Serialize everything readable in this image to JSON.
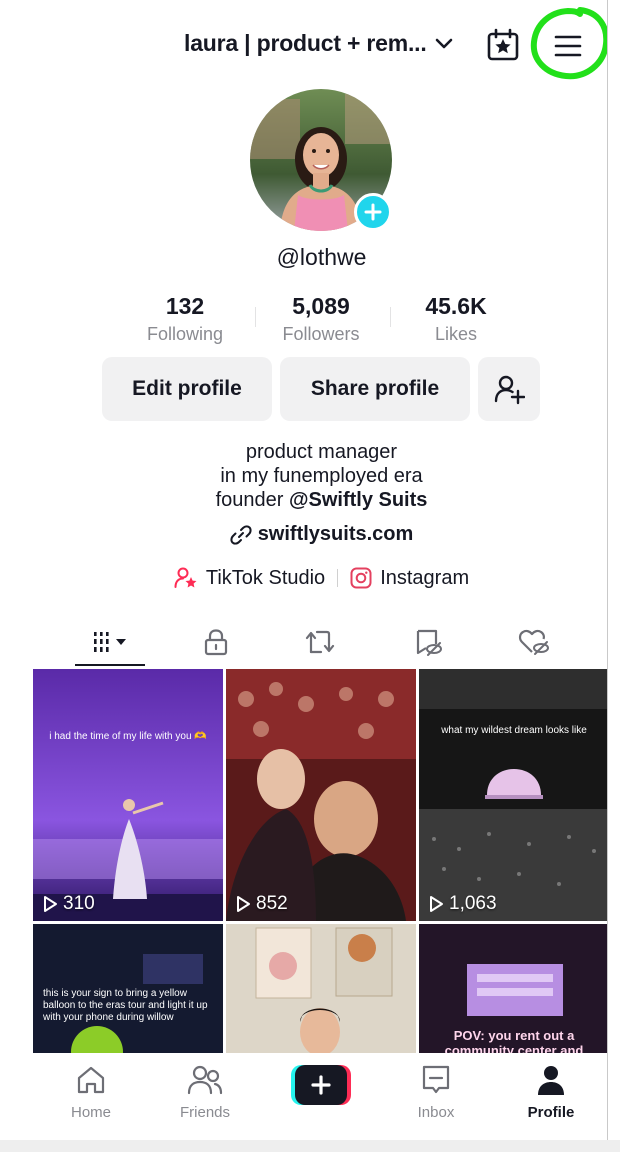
{
  "header": {
    "username": "laura | product + rem...",
    "icons": {
      "dropdown": "chevron-down-icon",
      "calendar": "calendar-star-icon",
      "menu": "hamburger-menu-icon"
    }
  },
  "profile": {
    "handle": "@lothwe",
    "stats": [
      {
        "value": "132",
        "label": "Following"
      },
      {
        "value": "5,089",
        "label": "Followers"
      },
      {
        "value": "45.6K",
        "label": "Likes"
      }
    ],
    "buttons": {
      "edit": "Edit profile",
      "share": "Share profile"
    },
    "bio": {
      "line1": "product manager",
      "line2": "in my funemployed era",
      "line3_prefix": "founder ",
      "line3_mention": "@Swiftly Suits"
    },
    "link": "swiftlysuits.com",
    "studio_label": "TikTok Studio",
    "instagram_label": "Instagram"
  },
  "videos": [
    {
      "views": "310",
      "caption": "i had the time of my life with you 🫶"
    },
    {
      "views": "852",
      "caption": ""
    },
    {
      "views": "1,063",
      "caption": "what my wildest dream looks like"
    },
    {
      "views": "",
      "caption": "this is your sign to bring a yellow balloon to the eras tour and light it up with your phone during willow"
    },
    {
      "views": "",
      "caption": ""
    },
    {
      "views": "",
      "caption": "POV: you rent out a community center and"
    }
  ],
  "nav": [
    {
      "label": "Home"
    },
    {
      "label": "Friends"
    },
    {
      "label": "Inbox"
    },
    {
      "label": "Profile"
    }
  ],
  "colors": {
    "accent_teal": "#20d5ec",
    "accent_pink": "#fe2c55",
    "annotation": "#22e01a"
  }
}
